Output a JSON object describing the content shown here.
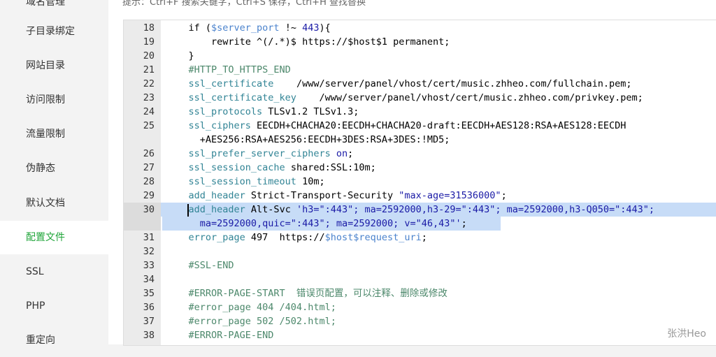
{
  "sidebar": {
    "items": [
      {
        "label": "域名管理"
      },
      {
        "label": "子目录绑定"
      },
      {
        "label": "网站目录"
      },
      {
        "label": "访问限制"
      },
      {
        "label": "流量限制"
      },
      {
        "label": "伪静态"
      },
      {
        "label": "默认文档"
      },
      {
        "label": "配置文件",
        "active": true
      },
      {
        "label": "SSL"
      },
      {
        "label": "PHP"
      },
      {
        "label": "重定向"
      }
    ]
  },
  "hint": "提示：Ctrl+F 搜索关键字，Ctrl+S 保存，Ctrl+H 查找替换",
  "editor": {
    "lines": [
      {
        "n": "18",
        "parts": [
          [
            "plain",
            "    if ("
          ],
          [
            "var",
            "$server_port"
          ],
          [
            "plain",
            " !~ "
          ],
          [
            "str",
            "443"
          ],
          [
            "plain",
            "){"
          ]
        ]
      },
      {
        "n": "19",
        "parts": [
          [
            "plain",
            "        rewrite ^(/.*)$ https://$host$1 permanent;"
          ]
        ]
      },
      {
        "n": "20",
        "parts": [
          [
            "plain",
            "    }"
          ]
        ]
      },
      {
        "n": "21",
        "parts": [
          [
            "comment",
            "    #HTTP_TO_HTTPS_END"
          ]
        ]
      },
      {
        "n": "22",
        "parts": [
          [
            "kw",
            "    ssl_certificate"
          ],
          [
            "plain",
            "    /www/server/panel/vhost/cert/music.zhheo.com/fullchain.pem;"
          ]
        ]
      },
      {
        "n": "23",
        "parts": [
          [
            "kw",
            "    ssl_certificate_key"
          ],
          [
            "plain",
            "    /www/server/panel/vhost/cert/music.zhheo.com/privkey.pem;"
          ]
        ]
      },
      {
        "n": "24",
        "parts": [
          [
            "kw",
            "    ssl_protocols"
          ],
          [
            "plain",
            " TLSv1.2 TLSv1.3;"
          ]
        ]
      },
      {
        "n": "25",
        "parts": [
          [
            "kw",
            "    ssl_ciphers"
          ],
          [
            "plain",
            " EECDH+CHACHA20:EECDH+CHACHA20-draft:EECDH+AES128:RSA+AES128:EECDH"
          ]
        ]
      },
      {
        "n": "",
        "parts": [
          [
            "plain",
            "      +AES256:RSA+AES256:EECDH+3DES:RSA+3DES:!MD5;"
          ]
        ]
      },
      {
        "n": "26",
        "parts": [
          [
            "kw",
            "    ssl_prefer_server_ciphers"
          ],
          [
            "plain",
            " "
          ],
          [
            "str",
            "on"
          ],
          [
            "plain",
            ";"
          ]
        ]
      },
      {
        "n": "27",
        "parts": [
          [
            "kw",
            "    ssl_session_cache"
          ],
          [
            "plain",
            " shared:SSL:10m;"
          ]
        ]
      },
      {
        "n": "28",
        "parts": [
          [
            "kw",
            "    ssl_session_timeout"
          ],
          [
            "plain",
            " 10m;"
          ]
        ]
      },
      {
        "n": "29",
        "parts": [
          [
            "kw",
            "    add_header"
          ],
          [
            "plain",
            " Strict-Transport-Security "
          ],
          [
            "str",
            "\"max-age=31536000\""
          ],
          [
            "plain",
            ";"
          ]
        ]
      },
      {
        "n": "30",
        "parts": [
          [
            "kw",
            "    add_header"
          ],
          [
            "plain",
            " Alt-Svc "
          ],
          [
            "str",
            "'h3=\":443\"; ma=2592000,h3-29=\":443\"; ma=2592000,h3-Q050=\":443\";"
          ]
        ]
      },
      {
        "n": "",
        "parts": [
          [
            "str",
            "      ma=2592000,quic=\":443\"; ma=2592000; v=\"46,43\"'"
          ],
          [
            "plain",
            ";"
          ]
        ]
      },
      {
        "n": "31",
        "parts": [
          [
            "kw",
            "    error_page"
          ],
          [
            "plain",
            " 497  https://"
          ],
          [
            "var",
            "$host$request_uri"
          ],
          [
            "plain",
            ";"
          ]
        ]
      },
      {
        "n": "32",
        "parts": [
          [
            "plain",
            ""
          ]
        ]
      },
      {
        "n": "33",
        "parts": [
          [
            "comment",
            "    #SSL-END"
          ]
        ]
      },
      {
        "n": "34",
        "parts": [
          [
            "plain",
            ""
          ]
        ]
      },
      {
        "n": "35",
        "parts": [
          [
            "comment",
            "    #ERROR-PAGE-START  错误页配置，可以注释、删除或修改"
          ]
        ]
      },
      {
        "n": "36",
        "parts": [
          [
            "comment",
            "    #error_page 404 /404.html;"
          ]
        ]
      },
      {
        "n": "37",
        "parts": [
          [
            "comment",
            "    #error_page 502 /502.html;"
          ]
        ]
      },
      {
        "n": "38",
        "parts": [
          [
            "comment",
            "    #ERROR-PAGE-END"
          ]
        ]
      }
    ]
  },
  "watermark": "张洪Heo"
}
